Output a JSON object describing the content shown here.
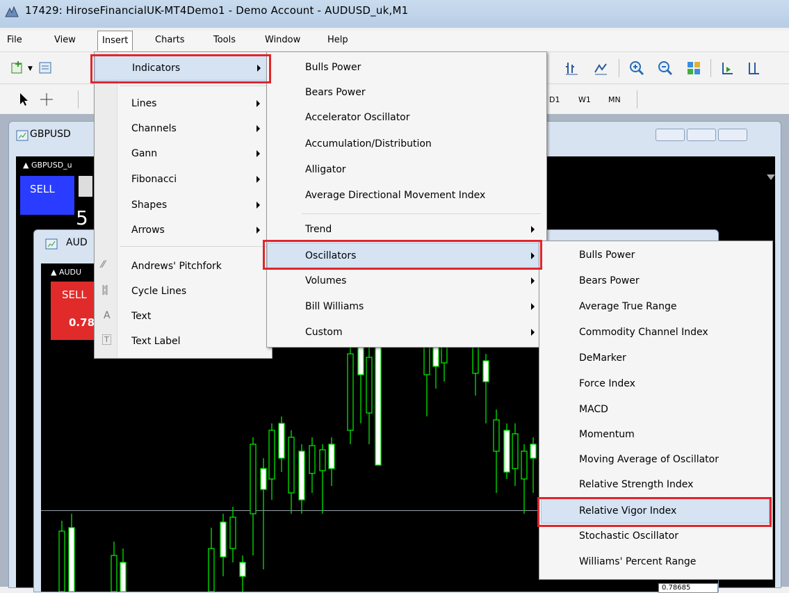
{
  "window": {
    "title": "17429: HiroseFinancialUK-MT4Demo1 - Demo Account - AUDUSD_uk,M1"
  },
  "menubar": [
    "File",
    "View",
    "Insert",
    "Charts",
    "Tools",
    "Window",
    "Help"
  ],
  "timeframes": [
    "D1",
    "W1",
    "MN"
  ],
  "charts": [
    {
      "title": "GBPUSD",
      "symbol": "GBPUSD_u",
      "sell": "SELL",
      "digit": "5"
    },
    {
      "title": "AUD",
      "symbol": "AUDU",
      "sell": "SELL",
      "price": "0.78",
      "price_tag": "0.78685"
    }
  ],
  "insert_menu": {
    "items": [
      {
        "label": "Indicators",
        "submenu": true
      },
      {
        "label": "Lines",
        "submenu": true
      },
      {
        "label": "Channels",
        "submenu": true
      },
      {
        "label": "Gann",
        "submenu": true
      },
      {
        "label": "Fibonacci",
        "submenu": true
      },
      {
        "label": "Shapes",
        "submenu": true
      },
      {
        "label": "Arrows",
        "submenu": true
      },
      {
        "label": "Andrews' Pitchfork",
        "icon": "pitchfork-icon"
      },
      {
        "label": "Cycle Lines",
        "icon": "cycle-lines-icon"
      },
      {
        "label": "Text",
        "icon": "text-icon"
      },
      {
        "label": "Text Label",
        "icon": "text-label-icon"
      }
    ]
  },
  "indicators_menu": {
    "items": [
      {
        "label": "Bulls Power"
      },
      {
        "label": "Bears Power"
      },
      {
        "label": "Accelerator Oscillator"
      },
      {
        "label": "Accumulation/Distribution"
      },
      {
        "label": "Alligator"
      },
      {
        "label": "Average Directional Movement Index"
      },
      {
        "label": "Trend",
        "submenu": true
      },
      {
        "label": "Oscillators",
        "submenu": true
      },
      {
        "label": "Volumes",
        "submenu": true
      },
      {
        "label": "Bill Williams",
        "submenu": true
      },
      {
        "label": "Custom",
        "submenu": true
      }
    ]
  },
  "oscillators_menu": {
    "items": [
      {
        "label": "Bulls Power"
      },
      {
        "label": "Bears Power"
      },
      {
        "label": "Average True Range"
      },
      {
        "label": "Commodity Channel Index"
      },
      {
        "label": "DeMarker"
      },
      {
        "label": "Force Index"
      },
      {
        "label": "MACD"
      },
      {
        "label": "Momentum"
      },
      {
        "label": "Moving Average of Oscillator"
      },
      {
        "label": "Relative Strength Index"
      },
      {
        "label": "Relative Vigor Index"
      },
      {
        "label": "Stochastic Oscillator"
      },
      {
        "label": "Williams' Percent Range"
      }
    ]
  },
  "colors": {
    "highlight": "#d5e3f3",
    "redbox": "#e0252c",
    "candle": "#00e600",
    "sell_blue": "#2a3cff",
    "sell_red": "#e12b2b"
  }
}
